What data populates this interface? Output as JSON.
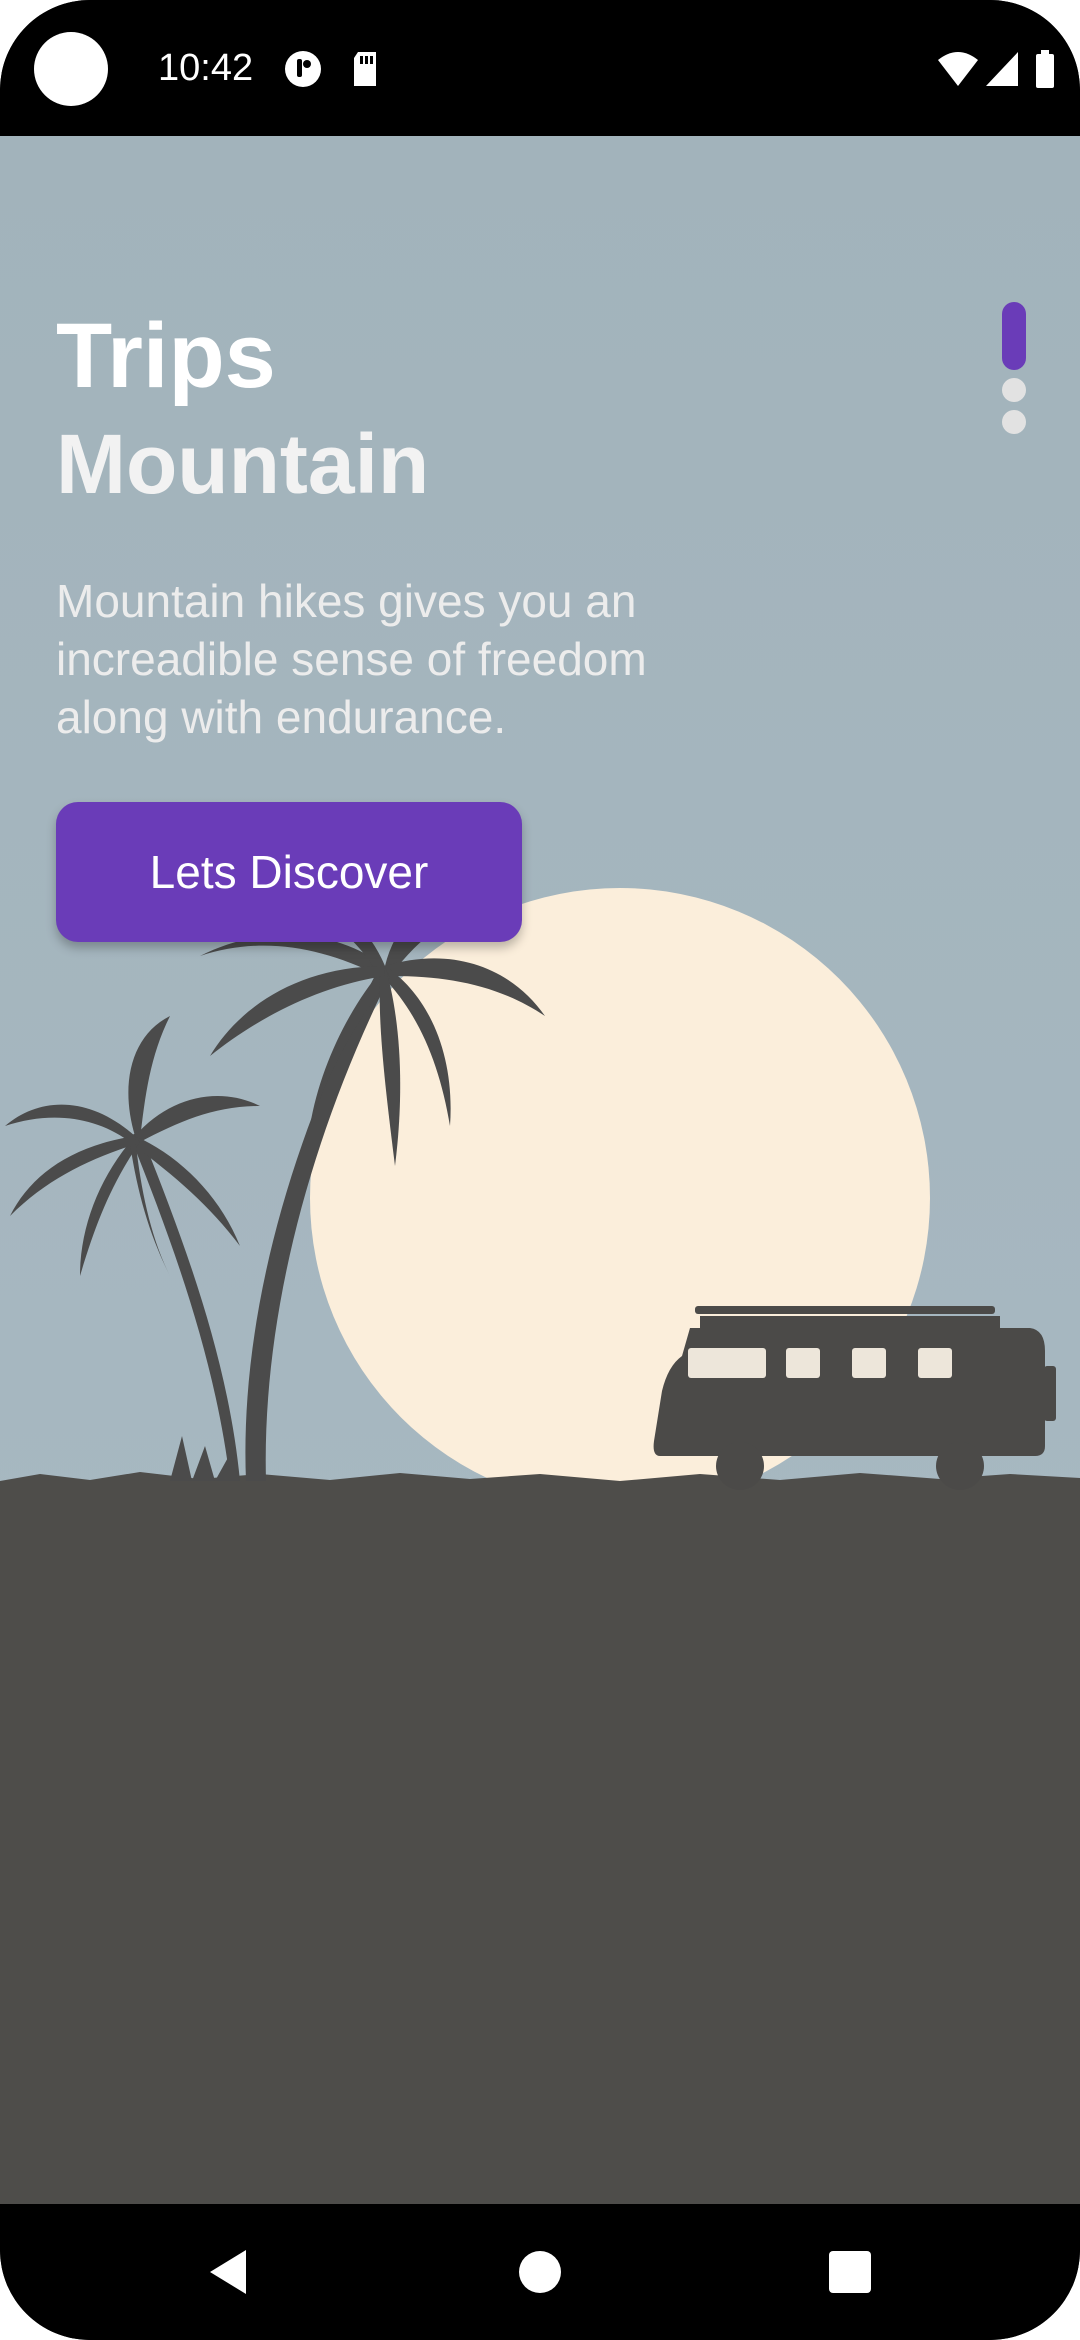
{
  "status_bar": {
    "time": "10:42",
    "icons": [
      "camera-cutout-icon",
      "notification-app-icon",
      "sd-card-icon",
      "wifi-icon",
      "cellular-signal-icon",
      "battery-icon"
    ]
  },
  "hero": {
    "title": "Trips",
    "subtitle": "Mountain",
    "description": "Mountain hikes gives you an increadible sense of freedom along with endurance.",
    "button_label": "Lets Discover"
  },
  "pager": {
    "count": 3,
    "active_index": 0
  },
  "nav_bar": {
    "icons": [
      "back-icon",
      "home-icon",
      "recents-icon"
    ]
  },
  "colors": {
    "accent": "#6a3cb8",
    "sky": "#a6b7c0",
    "sun": "#fbeedb",
    "ground": "#4e4d4a"
  }
}
